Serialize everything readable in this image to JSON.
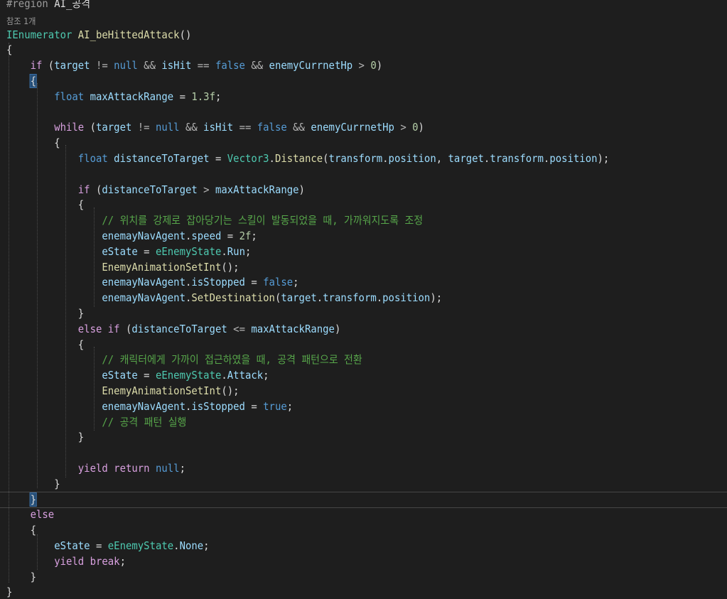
{
  "editor": {
    "lines": [
      {
        "tokens": [
          [
            "pp",
            "#region "
          ],
          [
            "plain",
            "AI_공격"
          ]
        ]
      },
      {
        "codelens": true,
        "tokens": [
          [
            "codelens",
            "참조 1개"
          ]
        ]
      },
      {
        "tokens": [
          [
            "type",
            "IEnumerator"
          ],
          [
            "plain",
            " "
          ],
          [
            "fn",
            "AI_beHittedAttack"
          ],
          [
            "plain",
            "()"
          ]
        ]
      },
      {
        "tokens": [
          [
            "plain",
            "{"
          ]
        ]
      },
      {
        "tokens": [
          [
            "plain",
            "    "
          ],
          [
            "ctl",
            "if"
          ],
          [
            "plain",
            " ("
          ],
          [
            "var",
            "target"
          ],
          [
            "plain",
            " "
          ],
          [
            "op",
            "!="
          ],
          [
            "plain",
            " "
          ],
          [
            "kw",
            "null"
          ],
          [
            "plain",
            " "
          ],
          [
            "op",
            "&&"
          ],
          [
            "plain",
            " "
          ],
          [
            "var",
            "isHit"
          ],
          [
            "plain",
            " "
          ],
          [
            "op",
            "=="
          ],
          [
            "plain",
            " "
          ],
          [
            "kw",
            "false"
          ],
          [
            "plain",
            " "
          ],
          [
            "op",
            "&&"
          ],
          [
            "plain",
            " "
          ],
          [
            "var",
            "enemyCurrnetHp"
          ],
          [
            "plain",
            " "
          ],
          [
            "op",
            ">"
          ],
          [
            "plain",
            " "
          ],
          [
            "num",
            "0"
          ],
          [
            "plain",
            ")"
          ]
        ]
      },
      {
        "tokens": [
          [
            "plain",
            "    "
          ],
          [
            "brace",
            "{"
          ]
        ]
      },
      {
        "tokens": [
          [
            "plain",
            "        "
          ],
          [
            "kw",
            "float"
          ],
          [
            "plain",
            " "
          ],
          [
            "var",
            "maxAttackRange"
          ],
          [
            "plain",
            " = "
          ],
          [
            "num",
            "1.3f"
          ],
          [
            "plain",
            ";"
          ]
        ]
      },
      {
        "tokens": []
      },
      {
        "tokens": [
          [
            "plain",
            "        "
          ],
          [
            "ctl",
            "while"
          ],
          [
            "plain",
            " ("
          ],
          [
            "var",
            "target"
          ],
          [
            "plain",
            " "
          ],
          [
            "op",
            "!="
          ],
          [
            "plain",
            " "
          ],
          [
            "kw",
            "null"
          ],
          [
            "plain",
            " "
          ],
          [
            "op",
            "&&"
          ],
          [
            "plain",
            " "
          ],
          [
            "var",
            "isHit"
          ],
          [
            "plain",
            " "
          ],
          [
            "op",
            "=="
          ],
          [
            "plain",
            " "
          ],
          [
            "kw",
            "false"
          ],
          [
            "plain",
            " "
          ],
          [
            "op",
            "&&"
          ],
          [
            "plain",
            " "
          ],
          [
            "var",
            "enemyCurrnetHp"
          ],
          [
            "plain",
            " "
          ],
          [
            "op",
            ">"
          ],
          [
            "plain",
            " "
          ],
          [
            "num",
            "0"
          ],
          [
            "plain",
            ")"
          ]
        ]
      },
      {
        "tokens": [
          [
            "plain",
            "        {"
          ]
        ]
      },
      {
        "tokens": [
          [
            "plain",
            "            "
          ],
          [
            "kw",
            "float"
          ],
          [
            "plain",
            " "
          ],
          [
            "var",
            "distanceToTarget"
          ],
          [
            "plain",
            " = "
          ],
          [
            "type",
            "Vector3"
          ],
          [
            "plain",
            "."
          ],
          [
            "fn",
            "Distance"
          ],
          [
            "plain",
            "("
          ],
          [
            "var",
            "transform"
          ],
          [
            "plain",
            "."
          ],
          [
            "var",
            "position"
          ],
          [
            "plain",
            ", "
          ],
          [
            "var",
            "target"
          ],
          [
            "plain",
            "."
          ],
          [
            "var",
            "transform"
          ],
          [
            "plain",
            "."
          ],
          [
            "var",
            "position"
          ],
          [
            "plain",
            ");"
          ]
        ]
      },
      {
        "tokens": []
      },
      {
        "tokens": [
          [
            "plain",
            "            "
          ],
          [
            "ctl",
            "if"
          ],
          [
            "plain",
            " ("
          ],
          [
            "var",
            "distanceToTarget"
          ],
          [
            "plain",
            " "
          ],
          [
            "op",
            ">"
          ],
          [
            "plain",
            " "
          ],
          [
            "var",
            "maxAttackRange"
          ],
          [
            "plain",
            ")"
          ]
        ]
      },
      {
        "tokens": [
          [
            "plain",
            "            {"
          ]
        ]
      },
      {
        "tokens": [
          [
            "plain",
            "                "
          ],
          [
            "cm",
            "// 위치를 강제로 잡아당기는 스킬이 발동되었을 때, 가까워지도록 조정"
          ]
        ]
      },
      {
        "tokens": [
          [
            "plain",
            "                "
          ],
          [
            "var",
            "enemayNavAgent"
          ],
          [
            "plain",
            "."
          ],
          [
            "var",
            "speed"
          ],
          [
            "plain",
            " = "
          ],
          [
            "num",
            "2f"
          ],
          [
            "plain",
            ";"
          ]
        ]
      },
      {
        "tokens": [
          [
            "plain",
            "                "
          ],
          [
            "var",
            "eState"
          ],
          [
            "plain",
            " = "
          ],
          [
            "type",
            "eEnemyState"
          ],
          [
            "plain",
            "."
          ],
          [
            "var",
            "Run"
          ],
          [
            "plain",
            ";"
          ]
        ]
      },
      {
        "tokens": [
          [
            "plain",
            "                "
          ],
          [
            "fn",
            "EnemyAnimationSetInt"
          ],
          [
            "plain",
            "();"
          ]
        ]
      },
      {
        "tokens": [
          [
            "plain",
            "                "
          ],
          [
            "var",
            "enemayNavAgent"
          ],
          [
            "plain",
            "."
          ],
          [
            "var",
            "isStopped"
          ],
          [
            "plain",
            " = "
          ],
          [
            "kw",
            "false"
          ],
          [
            "plain",
            ";"
          ]
        ]
      },
      {
        "tokens": [
          [
            "plain",
            "                "
          ],
          [
            "var",
            "enemayNavAgent"
          ],
          [
            "plain",
            "."
          ],
          [
            "fn",
            "SetDestination"
          ],
          [
            "plain",
            "("
          ],
          [
            "var",
            "target"
          ],
          [
            "plain",
            "."
          ],
          [
            "var",
            "transform"
          ],
          [
            "plain",
            "."
          ],
          [
            "var",
            "position"
          ],
          [
            "plain",
            ");"
          ]
        ]
      },
      {
        "tokens": [
          [
            "plain",
            "            }"
          ]
        ]
      },
      {
        "tokens": [
          [
            "plain",
            "            "
          ],
          [
            "ctl",
            "else"
          ],
          [
            "plain",
            " "
          ],
          [
            "ctl",
            "if"
          ],
          [
            "plain",
            " ("
          ],
          [
            "var",
            "distanceToTarget"
          ],
          [
            "plain",
            " "
          ],
          [
            "op",
            "<="
          ],
          [
            "plain",
            " "
          ],
          [
            "var",
            "maxAttackRange"
          ],
          [
            "plain",
            ")"
          ]
        ]
      },
      {
        "tokens": [
          [
            "plain",
            "            {"
          ]
        ]
      },
      {
        "tokens": [
          [
            "plain",
            "                "
          ],
          [
            "cm",
            "// 캐릭터에게 가까이 접근하였을 때, 공격 패턴으로 전환"
          ]
        ]
      },
      {
        "tokens": [
          [
            "plain",
            "                "
          ],
          [
            "var",
            "eState"
          ],
          [
            "plain",
            " = "
          ],
          [
            "type",
            "eEnemyState"
          ],
          [
            "plain",
            "."
          ],
          [
            "var",
            "Attack"
          ],
          [
            "plain",
            ";"
          ]
        ]
      },
      {
        "tokens": [
          [
            "plain",
            "                "
          ],
          [
            "fn",
            "EnemyAnimationSetInt"
          ],
          [
            "plain",
            "();"
          ]
        ]
      },
      {
        "tokens": [
          [
            "plain",
            "                "
          ],
          [
            "var",
            "enemayNavAgent"
          ],
          [
            "plain",
            "."
          ],
          [
            "var",
            "isStopped"
          ],
          [
            "plain",
            " = "
          ],
          [
            "kw",
            "true"
          ],
          [
            "plain",
            ";"
          ]
        ]
      },
      {
        "tokens": [
          [
            "plain",
            "                "
          ],
          [
            "cm",
            "// 공격 패턴 실행"
          ]
        ]
      },
      {
        "tokens": [
          [
            "plain",
            "            }"
          ]
        ]
      },
      {
        "tokens": []
      },
      {
        "tokens": [
          [
            "plain",
            "            "
          ],
          [
            "ctl",
            "yield"
          ],
          [
            "plain",
            " "
          ],
          [
            "ctl",
            "return"
          ],
          [
            "plain",
            " "
          ],
          [
            "kw",
            "null"
          ],
          [
            "plain",
            ";"
          ]
        ]
      },
      {
        "tokens": [
          [
            "plain",
            "        }"
          ]
        ]
      },
      {
        "current": true,
        "tokens": [
          [
            "plain",
            "    "
          ],
          [
            "brace",
            "}"
          ]
        ]
      },
      {
        "tokens": [
          [
            "plain",
            "    "
          ],
          [
            "ctl",
            "else"
          ]
        ]
      },
      {
        "tokens": [
          [
            "plain",
            "    {"
          ]
        ]
      },
      {
        "tokens": [
          [
            "plain",
            "        "
          ],
          [
            "var",
            "eState"
          ],
          [
            "plain",
            " = "
          ],
          [
            "type",
            "eEnemyState"
          ],
          [
            "plain",
            "."
          ],
          [
            "var",
            "None"
          ],
          [
            "plain",
            ";"
          ]
        ]
      },
      {
        "tokens": [
          [
            "plain",
            "        "
          ],
          [
            "ctl",
            "yield"
          ],
          [
            "plain",
            " "
          ],
          [
            "ctl",
            "break"
          ],
          [
            "plain",
            ";"
          ]
        ]
      },
      {
        "tokens": [
          [
            "plain",
            "    }"
          ]
        ]
      },
      {
        "tokens": [
          [
            "plain",
            "}"
          ]
        ]
      }
    ]
  }
}
